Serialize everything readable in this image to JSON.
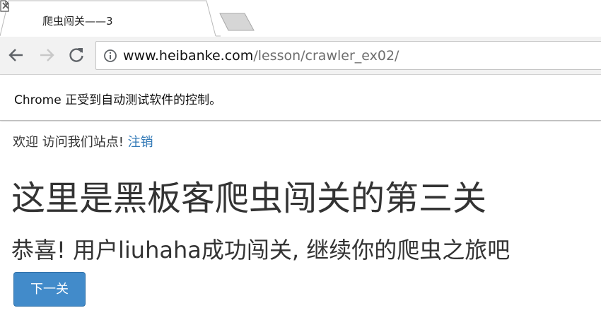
{
  "browser": {
    "tab": {
      "title": "爬虫闯关——3",
      "icon": "document-icon",
      "close_icon": "close-icon"
    },
    "toolbar": {
      "back_icon": "arrow-back-icon",
      "forward_icon": "arrow-forward-icon",
      "reload_icon": "reload-icon"
    },
    "omnibox": {
      "info_icon": "info-icon",
      "url_host": "www.heibanke.com",
      "url_path": "/lesson/crawler_ex02/"
    },
    "infobar": {
      "text": "Chrome 正受到自动测试软件的控制。"
    }
  },
  "page": {
    "welcome_text": "欢迎 访问我们站点!",
    "logout_link": "注销",
    "heading": "这里是黑板客爬虫闯关的第三关",
    "subheading": "恭喜! 用户liuhaha成功闯关, 继续你的爬虫之旅吧",
    "next_button": "下一关"
  },
  "colors": {
    "link": "#337ab7",
    "button_bg": "#428bca",
    "button_text": "#ffffff",
    "text": "#333333",
    "toolbar_bg": "#f2f2f2"
  }
}
